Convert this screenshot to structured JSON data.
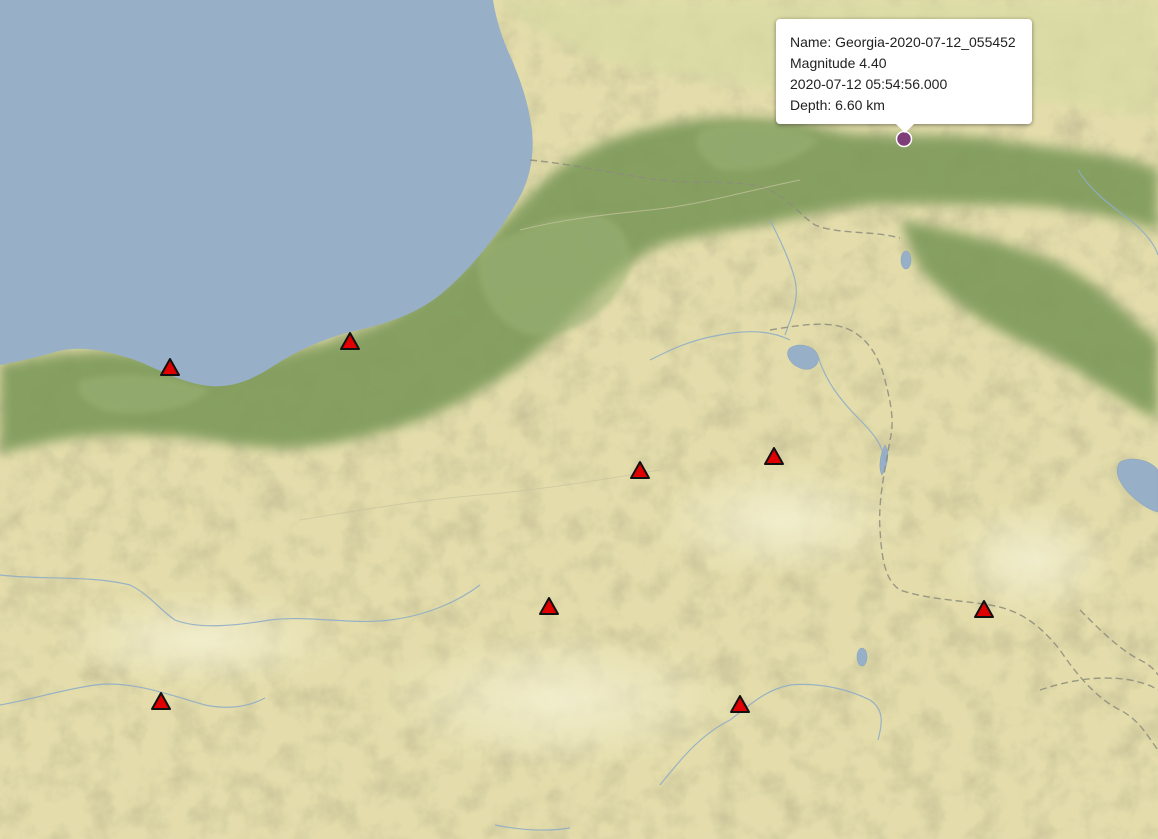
{
  "popup": {
    "name": "Name: Georgia-2020-07-12_055452",
    "magnitude": "Magnitude 4.40",
    "datetime": "2020-07-12 05:54:56.000",
    "depth": "Depth: 6.60 km"
  },
  "markers": {
    "station_icon": "red-triangle-icon",
    "station_color": "#e10000",
    "epicenter_icon": "circle-icon",
    "epicenter_color": "#7e3f78"
  },
  "basemap": {
    "sea_color": "#97b0c8",
    "land_color": "#e6dfae",
    "mountain_color": "#7e9b5d"
  }
}
